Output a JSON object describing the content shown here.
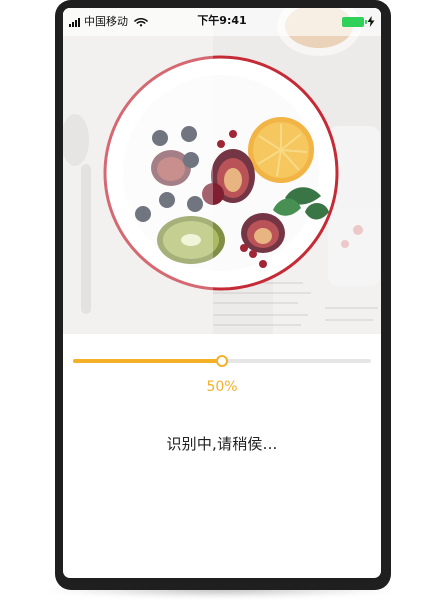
{
  "status_bar": {
    "carrier": "中国移动",
    "time": "下午9:41"
  },
  "progress": {
    "value": 0.5,
    "label": "50%"
  },
  "message": "识别中,请稍侯...",
  "colors": {
    "accent": "#f5b02a",
    "track": "#e6e6e6",
    "device": "#1f1f1f"
  },
  "icons": {
    "signal": "signal-icon",
    "wifi": "wifi-icon",
    "battery": "battery-icon",
    "charging": "charging-bolt-icon"
  }
}
